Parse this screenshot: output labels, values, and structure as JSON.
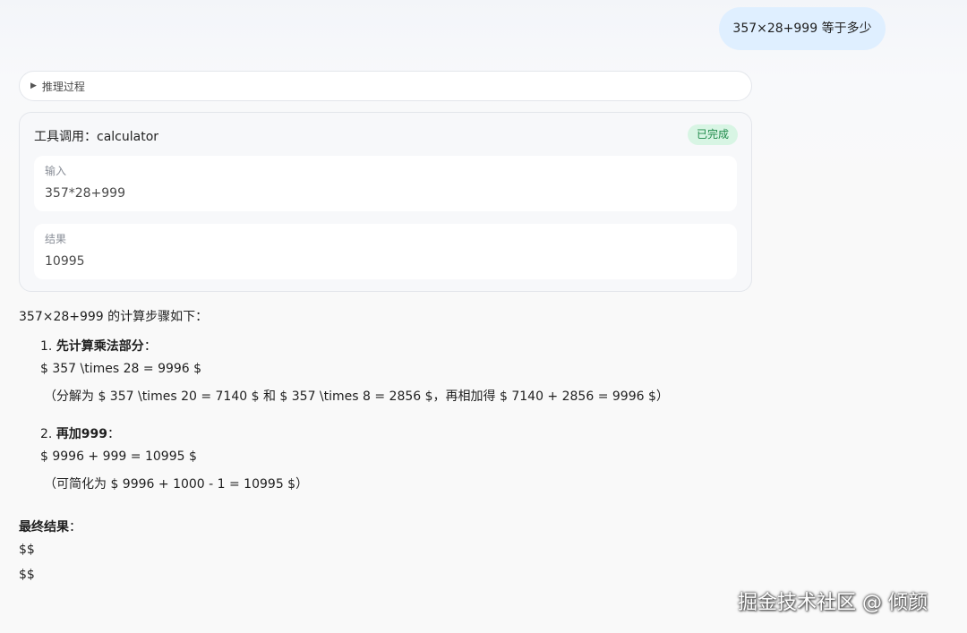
{
  "user_message": "357×28+999 等于多少",
  "reasoning": {
    "arrow": "▶",
    "label": "推理过程"
  },
  "tool_call": {
    "title": "工具调用：calculator",
    "status": "已完成",
    "input_label": "输入",
    "input_value": "357*28+999",
    "result_label": "结果",
    "result_value": "10995"
  },
  "answer": {
    "intro": "357×28+999 的计算步骤如下：",
    "step1_num": "1. ",
    "step1_title": "先计算乘法部分",
    "step1_colon": "：",
    "step1_formula": "$ 357 \\times 28 = 9996 $",
    "step1_note": "（分解为 $ 357 \\times 20 = 7140 $ 和 $ 357 \\times 8 = 2856 $，再相加得 $ 7140 + 2856 = 9996 $）",
    "step2_num": "2. ",
    "step2_title": "再加999",
    "step2_colon": "：",
    "step2_formula": "$ 9996 + 999 = 10995 $",
    "step2_note": "（可简化为 $ 9996 + 1000 - 1 = 10995 $）",
    "final_title": "最终结果",
    "final_colon": "：",
    "final_line1": "$$",
    "final_line2": "$$"
  },
  "watermark": "掘金技术社区 @ 倾颜"
}
